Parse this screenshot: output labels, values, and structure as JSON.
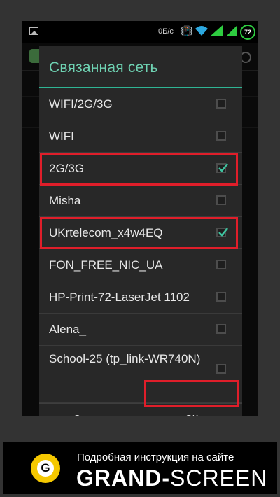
{
  "status_bar": {
    "data_speed": "0Б/с",
    "battery_level": "72",
    "icons": [
      "image-notification-icon",
      "vibrate-icon",
      "wifi-icon",
      "signal-icon",
      "signal-icon",
      "battery-icon"
    ]
  },
  "dialog": {
    "title": "Связанная сеть",
    "items": [
      {
        "label": "WIFI/2G/3G",
        "checked": false,
        "highlighted": false
      },
      {
        "label": "WIFI",
        "checked": false,
        "highlighted": false
      },
      {
        "label": "2G/3G",
        "checked": true,
        "highlighted": true
      },
      {
        "label": "Misha",
        "checked": false,
        "highlighted": false
      },
      {
        "label": "UKrtelecom_x4w4EQ",
        "checked": true,
        "highlighted": true
      },
      {
        "label": "FON_FREE_NIC_UA",
        "checked": false,
        "highlighted": false
      },
      {
        "label": "HP-Print-72-LaserJet 1102",
        "checked": false,
        "highlighted": false
      },
      {
        "label": "Alena_",
        "checked": false,
        "highlighted": false
      },
      {
        "label": "School-25 (tp_link-WR740N)",
        "checked": false,
        "highlighted": false
      }
    ],
    "cancel_label": "Отмена",
    "ok_label": "OK"
  },
  "banner": {
    "subtitle": "Подробная инструкция на сайте",
    "brand_bold": "GRAND-",
    "brand_light": "SCREEN",
    "logo_letter": "G"
  },
  "colors": {
    "accent": "#2fb594",
    "title": "#6fd3b3",
    "highlight": "#e01e2a",
    "logo": "#f5c800"
  }
}
